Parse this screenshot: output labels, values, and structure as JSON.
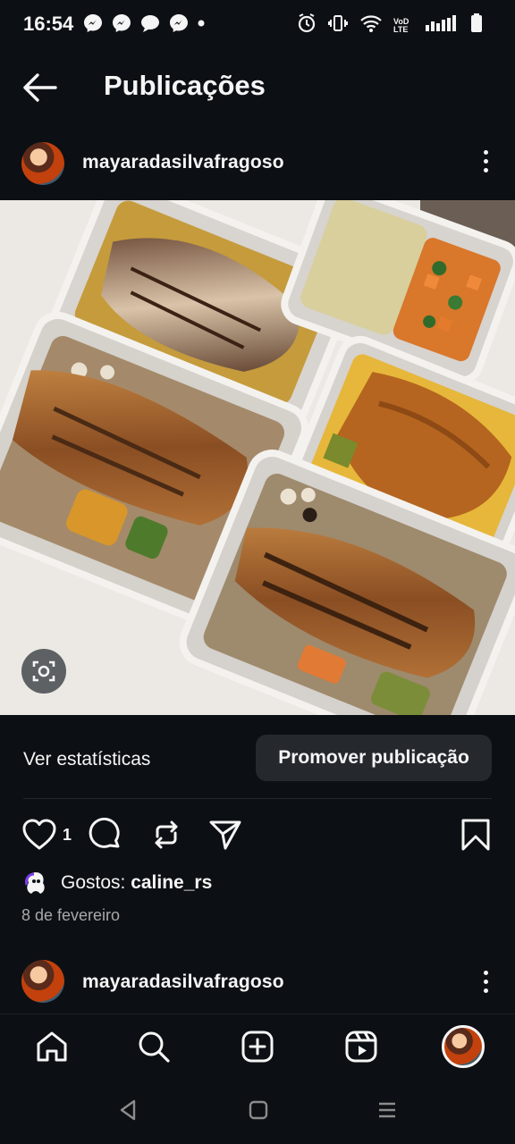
{
  "status_bar": {
    "time": "16:54",
    "left_icons": [
      "messenger-icon",
      "messenger-icon",
      "chat-bubble-icon",
      "messenger-icon",
      "dot"
    ],
    "right_icons": [
      "alarm-icon",
      "vibrate-icon",
      "wifi-icon",
      "volte-icon",
      "signal-icon",
      "battery-icon"
    ],
    "volte_label": "VoD LTE"
  },
  "header": {
    "title": "Publicações"
  },
  "post": {
    "username": "mayaradasilvafragoso",
    "image_alt": "Meal prep containers with grilled fish, chicken, rice, beans, vegetables and mashed potatoes",
    "insights_label": "Ver estatísticas",
    "promote_label": "Promover publicação",
    "like_count": "1",
    "likes_prefix": "Gostos: ",
    "likes_user": "caline_rs",
    "date": "8 de fevereiro"
  },
  "next_post": {
    "username": "mayaradasilvafragoso"
  },
  "bottom_nav": [
    "home-icon",
    "search-icon",
    "create-icon",
    "reels-icon",
    "profile-avatar"
  ],
  "system_nav": [
    "back",
    "home",
    "recents"
  ],
  "colors": {
    "background": "#0c1014",
    "text": "#f5f5f5",
    "secondary_text": "#a8a8a8",
    "button_bg": "#25292e"
  }
}
